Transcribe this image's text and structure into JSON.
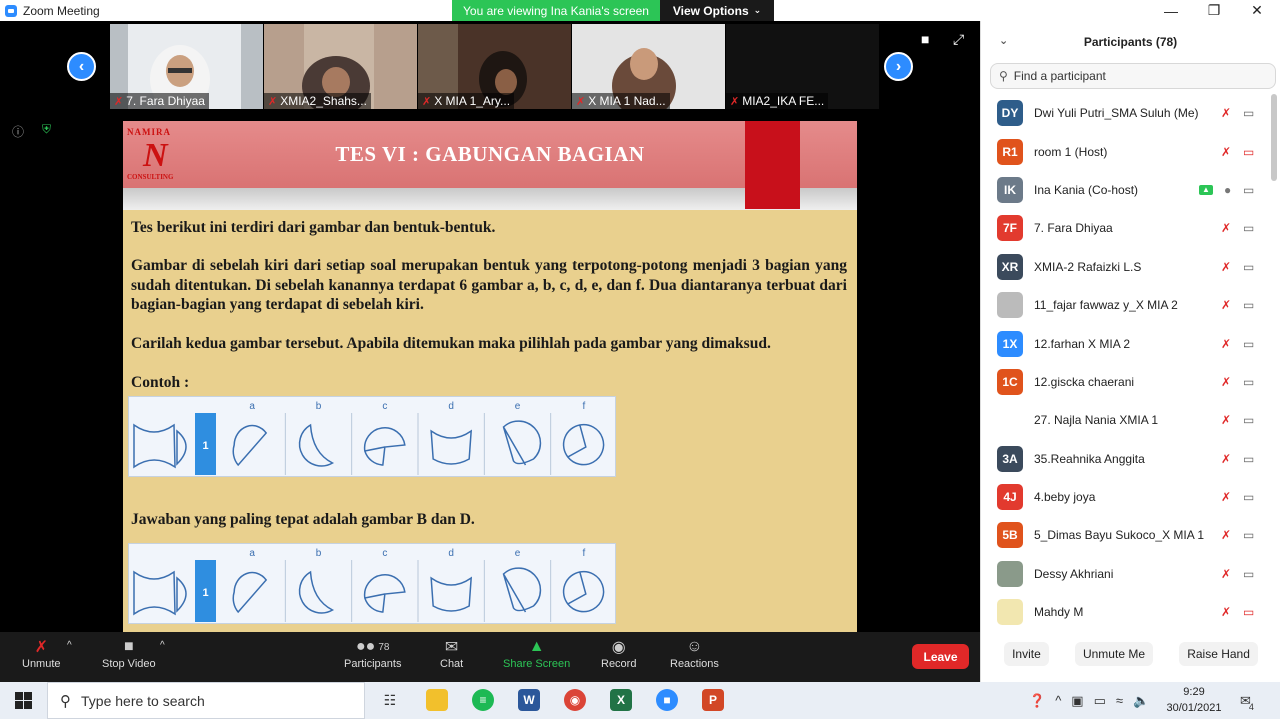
{
  "window": {
    "title": "Zoom Meeting",
    "viewing_banner": "You are viewing Ina Kania's screen",
    "view_options_label": "View Options"
  },
  "thumbnails": [
    {
      "label": "7. Fara Dhiyaa"
    },
    {
      "label": "XMIA2_Shahs..."
    },
    {
      "label": "X MIA 1_Ary..."
    },
    {
      "label": "X MIA 1 Nad..."
    },
    {
      "label": "MIA2_IKA FE..."
    }
  ],
  "slide": {
    "logo_top": "NAMIRA",
    "logo_letter": "N",
    "logo_bottom": "CONSULTING",
    "title": "TES VI : GABUNGAN BAGIAN",
    "p1": "Tes berikut ini terdiri dari gambar dan bentuk-bentuk.",
    "p2": "Gambar di sebelah kiri dari setiap soal merupakan bentuk yang terpotong-potong menjadi 3 bagian yang sudah ditentukan. Di sebelah kanannya terdapat 6 gambar a, b, c, d, e, dan f. Dua diantaranya terbuat dari bagian-bagian yang terdapat di sebelah kiri.",
    "p3": "Carilah kedua gambar tersebut. Apabila ditemukan maka pilihlah pada gambar yang dimaksud.",
    "contoh": "Contoh :",
    "answer": "Jawaban yang paling tepat adalah gambar B dan D.",
    "question_number": "1",
    "options": [
      "a",
      "b",
      "c",
      "d",
      "e",
      "f"
    ]
  },
  "participants_panel": {
    "title": "Participants (78)",
    "search_placeholder": "Find a participant",
    "items": [
      {
        "initials": "DY",
        "name": "Dwi Yuli Putri_SMA Suluh (Me)",
        "color": "#2e5d8a",
        "video_off": false
      },
      {
        "initials": "R1",
        "name": "room 1 (Host)",
        "color": "#e0531c",
        "video_off": true
      },
      {
        "initials": "IK",
        "name": "Ina Kania (Co-host)",
        "color": "#6c7a89",
        "video_off": false
      },
      {
        "initials": "7F",
        "name": "7. Fara Dhiyaa",
        "color": "#e23a2e",
        "video_off": false
      },
      {
        "initials": "XR",
        "name": "XMIA-2 Rafaizki L.S",
        "color": "#3b4a5c",
        "video_off": false
      },
      {
        "initials": "",
        "name": "11_fajar fawwaz y_X MIA 2",
        "color": "#bbbbbb",
        "video_off": false
      },
      {
        "initials": "1X",
        "name": "12.farhan X MIA 2",
        "color": "#2d8cff",
        "video_off": false
      },
      {
        "initials": "1C",
        "name": "12.giscka chaerani",
        "color": "#e0531c",
        "video_off": false
      },
      {
        "initials": "",
        "name": "27. Najla Nania XMIA 1",
        "color": "#ffffff",
        "video_off": false
      },
      {
        "initials": "3A",
        "name": "35.Reahnika Anggita",
        "color": "#3b4a5c",
        "video_off": false
      },
      {
        "initials": "4J",
        "name": "4.beby joya",
        "color": "#e23a2e",
        "video_off": false
      },
      {
        "initials": "5B",
        "name": "5_Dimas Bayu Sukoco_X MIA 1",
        "color": "#e0531c",
        "video_off": false
      },
      {
        "initials": "",
        "name": "Dessy Akhriani",
        "color": "#8a9a8a",
        "video_off": false
      },
      {
        "initials": "",
        "name": "Mahdy M",
        "color": "#f2e7b0",
        "video_off": true
      }
    ],
    "buttons": {
      "invite": "Invite",
      "unmute_me": "Unmute Me",
      "raise_hand": "Raise Hand"
    }
  },
  "toolbar": {
    "unmute": "Unmute",
    "stop_video": "Stop Video",
    "participants": "Participants",
    "participants_count": "78",
    "chat": "Chat",
    "share_screen": "Share Screen",
    "record": "Record",
    "reactions": "Reactions",
    "leave": "Leave"
  },
  "taskbar": {
    "search_placeholder": "Type here to search",
    "time": "9:29",
    "date": "30/01/2021",
    "notifications": "4"
  }
}
